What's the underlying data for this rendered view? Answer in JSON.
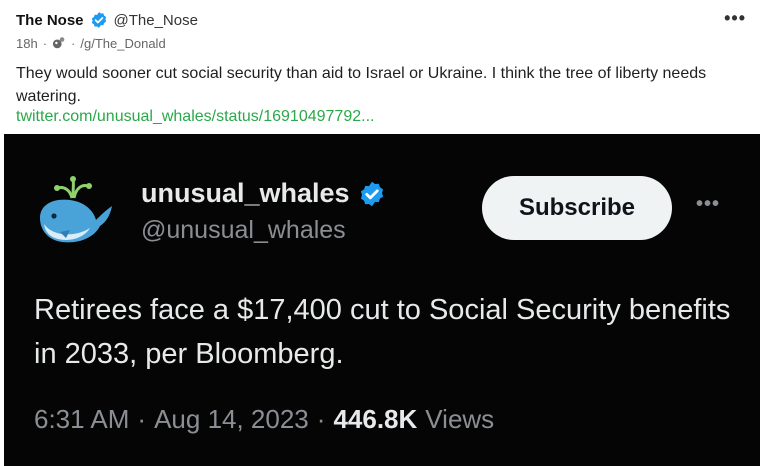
{
  "post": {
    "author_name": "The Nose",
    "author_handle": "@The_Nose",
    "time": "18h",
    "community": "/g/The_Donald",
    "body": "They would sooner cut social security than aid to Israel or Ukraine. I think the tree of liberty needs watering.",
    "link_text": "twitter.com/unusual_whales/status/16910497792...",
    "more_icon": "more-horizontal-icon"
  },
  "embed": {
    "name": "unusual_whales",
    "handle": "@unusual_whales",
    "subscribe_label": "Subscribe",
    "text": "Retirees face a $17,400 cut to Social Security benefits in 2033, per Bloomberg.",
    "time": "6:31 AM",
    "date": "Aug 14, 2023",
    "views_count": "446.8K",
    "views_label": "Views"
  },
  "colors": {
    "verified_blue": "#1d9bf0",
    "link_green": "#2aa84a",
    "embed_bg": "#050505"
  }
}
